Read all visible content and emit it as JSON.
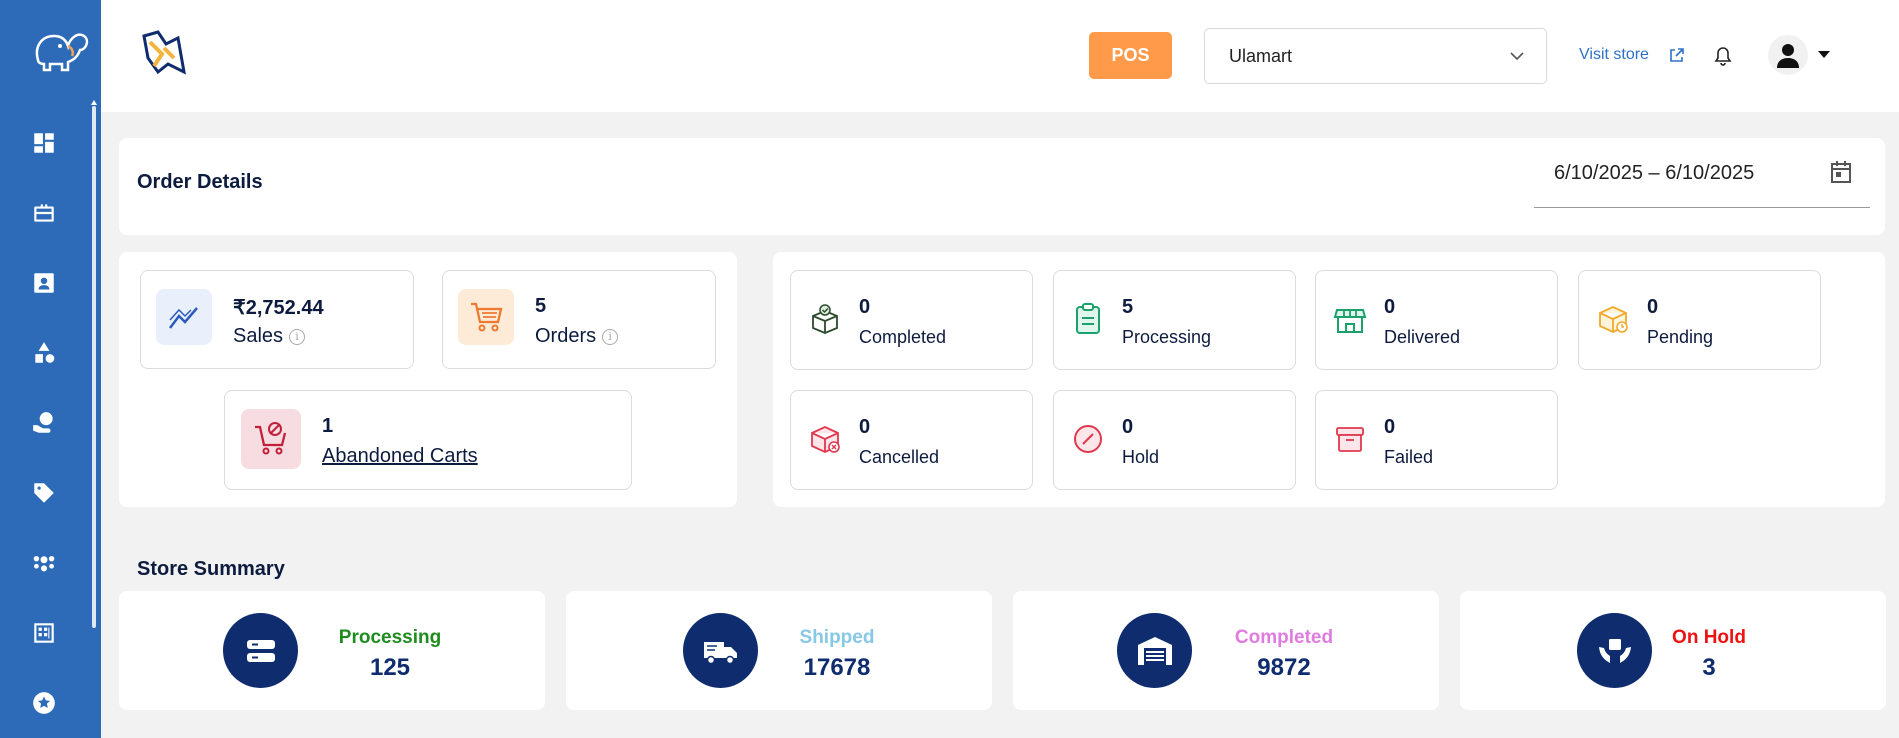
{
  "topbar": {
    "pos_label": "POS",
    "store_selected": "Ulamart",
    "visit_store_label": "Visit store"
  },
  "order_details": {
    "title": "Order Details",
    "date_range": "6/10/2025 – 6/10/2025"
  },
  "overview": {
    "sales": {
      "value": "₹2,752.44",
      "label": "Sales"
    },
    "orders": {
      "value": "5",
      "label": "Orders"
    },
    "abandoned": {
      "value": "1",
      "label": "Abandoned Carts"
    }
  },
  "statuses": [
    {
      "value": "0",
      "label": "Completed"
    },
    {
      "value": "5",
      "label": "Processing"
    },
    {
      "value": "0",
      "label": "Delivered"
    },
    {
      "value": "0",
      "label": "Pending"
    },
    {
      "value": "0",
      "label": "Cancelled"
    },
    {
      "value": "0",
      "label": "Hold"
    },
    {
      "value": "0",
      "label": "Failed"
    }
  ],
  "store_summary": {
    "title": "Store Summary",
    "items": [
      {
        "label": "Processing",
        "value": "125",
        "color": "#1e8c1e"
      },
      {
        "label": "Shipped",
        "value": "17678",
        "color": "#86c8e6"
      },
      {
        "label": "Completed",
        "value": "9872",
        "color": "#e07be0"
      },
      {
        "label": "On Hold",
        "value": "3",
        "color": "#ee1111"
      }
    ]
  },
  "colors": {
    "sidebar": "#2d6bb8",
    "pos_button": "#ff9a4a",
    "summary_circle": "#0f2d6e"
  },
  "icons": {
    "sidebar": [
      "dashboard-icon",
      "briefcase-icon",
      "contact-card-icon",
      "shapes-icon",
      "verified-hand-icon",
      "tag-icon",
      "people-group-icon",
      "grid-icon",
      "star-icon"
    ]
  }
}
